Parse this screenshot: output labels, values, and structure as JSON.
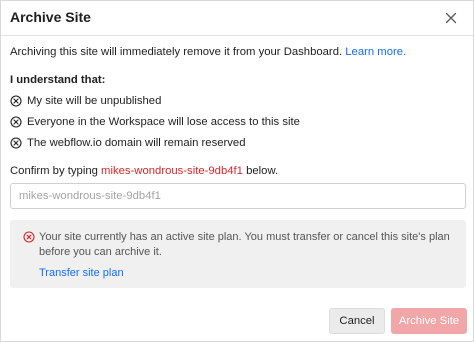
{
  "dialog": {
    "title": "Archive Site",
    "close_icon": "close-icon"
  },
  "intro": {
    "text": "Archiving this site will immediately remove it from your Dashboard. ",
    "link": "Learn more."
  },
  "understand": {
    "heading": "I understand that:",
    "icon": "x-circle-icon",
    "items": [
      "My site will be unpublished",
      "Everyone in the Workspace will lose access to this site",
      "The webflow.io domain will remain reserved"
    ]
  },
  "confirm": {
    "prefix": "Confirm by typing ",
    "site_name": "mikes-wondrous-site-9db4f1",
    "suffix": " below.",
    "placeholder": "mikes-wondrous-site-9db4f1",
    "value": ""
  },
  "alert": {
    "icon": "error-circle-icon",
    "message": "Your site currently has an active site plan. You must transfer or cancel this site's plan before you can archive it.",
    "link": "Transfer site plan"
  },
  "buttons": {
    "cancel": "Cancel",
    "archive": "Archive Site"
  },
  "colors": {
    "link": "#146ef5",
    "site_name": "#d6262b",
    "alert_icon": "#d6262b",
    "archive_disabled": "#f1a6a8"
  }
}
